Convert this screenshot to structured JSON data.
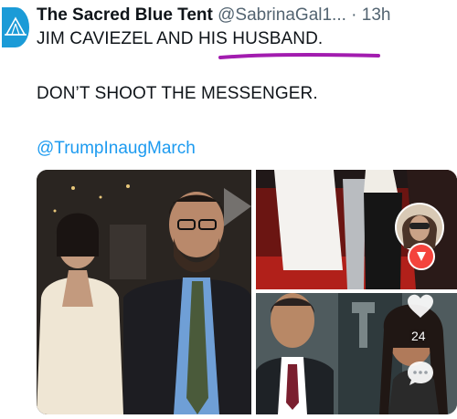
{
  "tweet": {
    "display_name": "The Sacred Blue Tent",
    "handle": "@SabrinaGal1...",
    "separator": "·",
    "time": "13h",
    "line1": "JIM CAVIEZEL AND HIS HUSBAND.",
    "line2": "DON’T SHOOT THE MESSENGER.",
    "mention": "@TrumpInaugMarch"
  },
  "overlay": {
    "like_count": "24"
  },
  "colors": {
    "link": "#1d9bf0",
    "avatar": "#1b9bd7",
    "underline": "#a21caf",
    "record_badge": "#f4433c"
  },
  "icons": [
    "tent-icon",
    "record-icon",
    "heart-icon",
    "comment-icon"
  ]
}
